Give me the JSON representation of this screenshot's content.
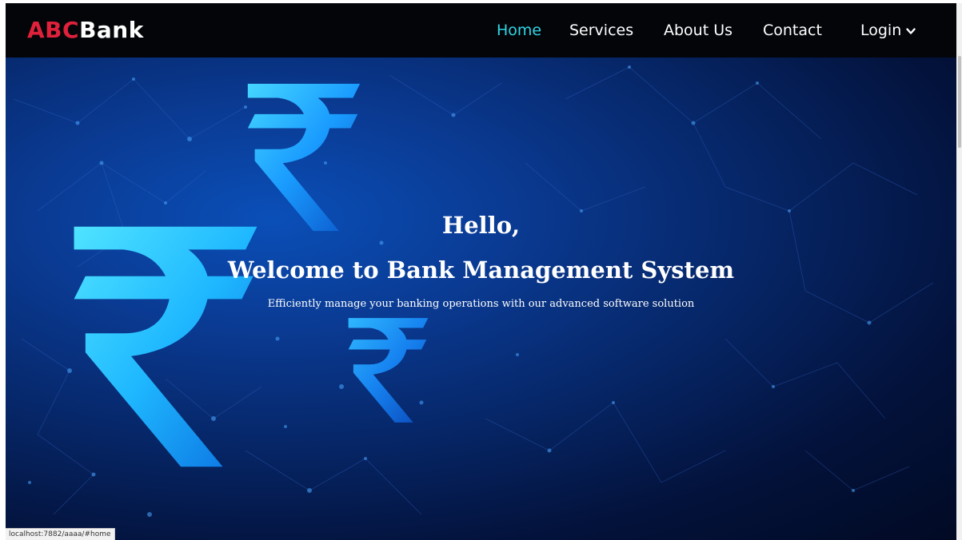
{
  "brand": {
    "part1": "ABC",
    "part2": "Bank",
    "part1_color": "#e0213b",
    "part2_color": "#ffffff"
  },
  "nav": {
    "items": [
      {
        "label": "Home",
        "active": true
      },
      {
        "label": "Services",
        "active": false
      },
      {
        "label": "About Us",
        "active": false
      },
      {
        "label": "Contact",
        "active": false
      },
      {
        "label": "Login",
        "active": false,
        "icon": "chevron-down-icon"
      }
    ],
    "active_color": "#31d6e6"
  },
  "hero": {
    "greeting": "Hello,",
    "title": "Welcome to Bank Management System",
    "subtitle": "Efficiently manage your banking operations with our advanced software solution",
    "background_icon": "rupee-icon",
    "accent_color": "#1fb8ff"
  },
  "status": {
    "url": "localhost:7882/aaaa/#home"
  }
}
